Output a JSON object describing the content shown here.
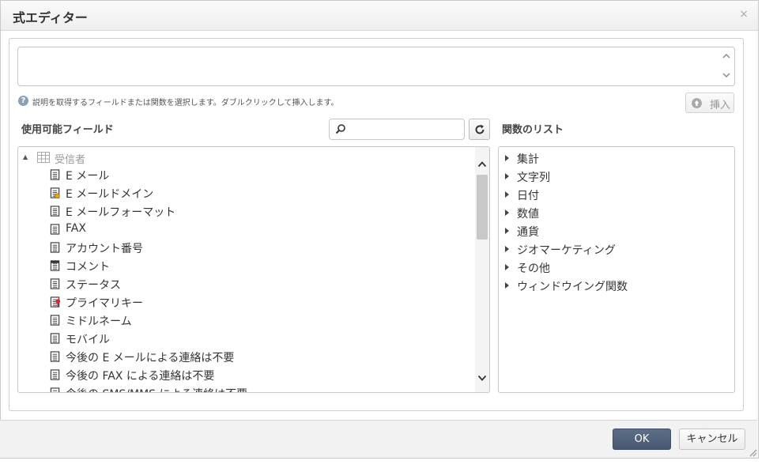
{
  "dialog": {
    "title": "式エディター",
    "close_label": "×"
  },
  "expression": {
    "value": ""
  },
  "help": {
    "icon_glyph": "?",
    "text": "説明を取得するフィールドまたは関数を選択します。ダブルクリックして挿入します。"
  },
  "insert_button": {
    "label": "挿入"
  },
  "fields": {
    "title": "使用可能フィールド",
    "search_value": "",
    "root": {
      "label": "受信者"
    },
    "items": [
      {
        "label": "E メール",
        "icon": "text-field-icon"
      },
      {
        "label": "E メールドメイン",
        "icon": "computed-field-icon"
      },
      {
        "label": "E メールフォーマット",
        "icon": "text-field-icon"
      },
      {
        "label": "FAX",
        "icon": "text-field-icon"
      },
      {
        "label": "アカウント番号",
        "icon": "text-field-icon"
      },
      {
        "label": "コメント",
        "icon": "memo-field-icon"
      },
      {
        "label": "ステータス",
        "icon": "text-field-icon"
      },
      {
        "label": "プライマリキー",
        "icon": "key-field-icon"
      },
      {
        "label": "ミドルネーム",
        "icon": "text-field-icon"
      },
      {
        "label": "モバイル",
        "icon": "text-field-icon"
      },
      {
        "label": "今後の E メールによる連絡は不要",
        "icon": "text-field-icon"
      },
      {
        "label": "今後の FAX による連絡は不要",
        "icon": "text-field-icon"
      },
      {
        "label": "今後の SMS/MMS による連絡は不要",
        "icon": "text-field-icon"
      }
    ]
  },
  "functions": {
    "title": "関数のリスト",
    "items": [
      {
        "label": "集計"
      },
      {
        "label": "文字列"
      },
      {
        "label": "日付"
      },
      {
        "label": "数値"
      },
      {
        "label": "通貨"
      },
      {
        "label": "ジオマーケティング"
      },
      {
        "label": "その他"
      },
      {
        "label": "ウィンドウイング関数"
      }
    ]
  },
  "footer": {
    "ok_label": "OK",
    "cancel_label": "キャンセル"
  },
  "colors": {
    "ok_button": "#4e5f7a",
    "help_icon": "#8aa0b4",
    "key_icon": "#e0202f",
    "computed_icon": "#e8a317"
  }
}
